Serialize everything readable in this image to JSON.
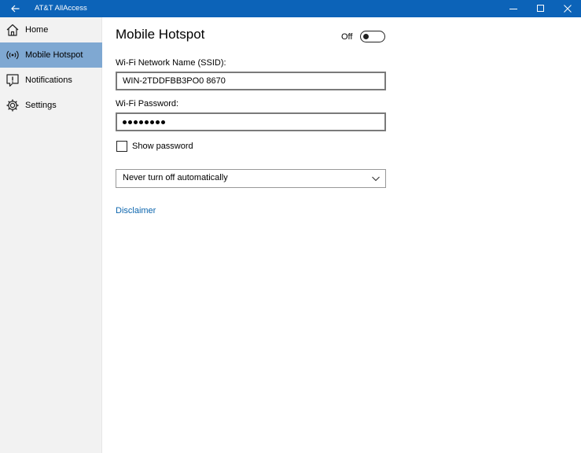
{
  "window": {
    "title": "AT&T AllAccess"
  },
  "sidebar": {
    "items": [
      {
        "label": "Home",
        "icon": "home-icon"
      },
      {
        "label": "Mobile Hotspot",
        "icon": "hotspot-icon"
      },
      {
        "label": "Notifications",
        "icon": "notification-icon"
      },
      {
        "label": "Settings",
        "icon": "gear-icon"
      }
    ],
    "active_item": "Mobile Hotspot"
  },
  "main": {
    "title": "Mobile Hotspot",
    "toggle": {
      "state_label": "Off",
      "on": false
    },
    "ssid": {
      "label": "Wi-Fi Network Name (SSID):",
      "value": "WIN-2TDDFBB3PO0 8670"
    },
    "password": {
      "label": "Wi-Fi Password:",
      "masked_length": 8
    },
    "show_password": {
      "label": "Show password",
      "checked": false
    },
    "auto_off": {
      "selected": "Never turn off automatically"
    },
    "disclaimer_link": "Disclaimer"
  },
  "colors": {
    "titlebar": "#0c63b8",
    "sidebar_bg": "#f2f2f2",
    "active_item": "#7fa8d2",
    "link": "#0a64ad"
  }
}
